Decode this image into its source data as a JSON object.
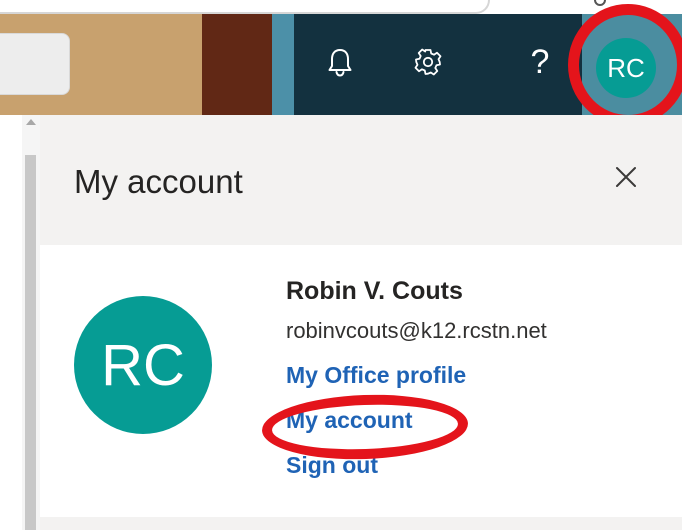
{
  "header": {
    "me_initials": "RC",
    "notifications_icon": "bell-icon",
    "settings_icon": "gear-icon",
    "help_label": "?"
  },
  "account_panel": {
    "title": "My account",
    "close_icon": "close-icon",
    "user": {
      "initials": "RC",
      "name": "Robin V. Couts",
      "email": "robinvcouts@k12.rcstn.net"
    },
    "links": {
      "office_profile": "My Office profile",
      "my_account": "My account",
      "sign_out": "Sign out"
    }
  },
  "colors": {
    "topbar": "#13313f",
    "banner_gold": "#c8a16e",
    "banner_brown": "#612815",
    "avatar": "#069c94",
    "link": "#1f63b5",
    "annotation": "#e4141b"
  }
}
